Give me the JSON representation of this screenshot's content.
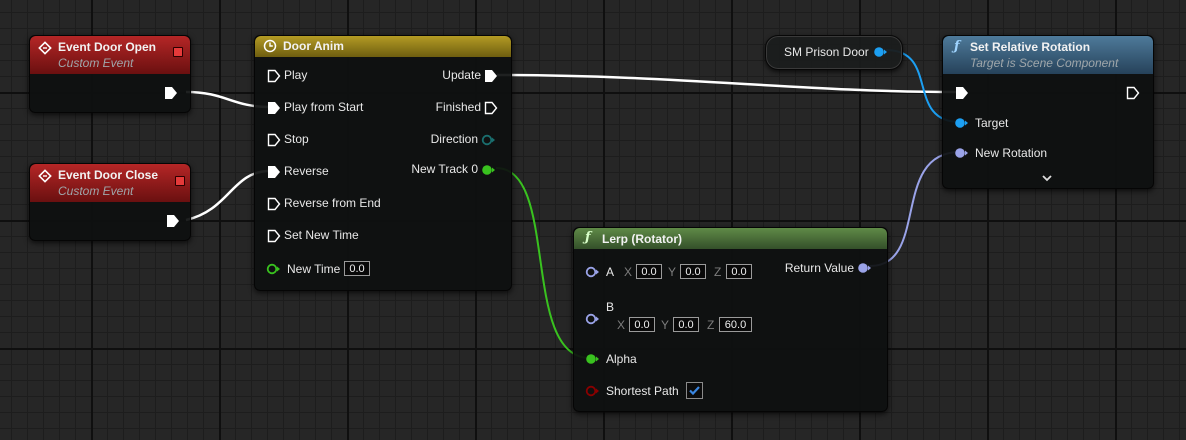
{
  "colors": {
    "exec_pin": "#ffffff",
    "float_pin": "#39c21f",
    "object_pin": "#1c9ff2",
    "rotator_pin": "#9aa3e8",
    "bool_pin": "#8b0000",
    "direction_pin": "#1a6f6f",
    "event_header": "#9b1d1d",
    "timeline_header": "#9e8a20",
    "function_header": "#3b5e79",
    "pure_function_header": "#4a6b38"
  },
  "nodes": {
    "event_open": {
      "title": "Event Door Open",
      "subtitle": "Custom Event"
    },
    "event_close": {
      "title": "Event Door Close",
      "subtitle": "Custom Event"
    },
    "timeline": {
      "title": "Door Anim",
      "inputs": [
        "Play",
        "Play from Start",
        "Stop",
        "Reverse",
        "Reverse from End",
        "Set New Time"
      ],
      "new_time_label": "New Time",
      "new_time_value": "0.0",
      "outputs": {
        "update": "Update",
        "finished": "Finished",
        "direction": "Direction",
        "track": "New Track 0"
      }
    },
    "variable": {
      "label": "SM Prison Door"
    },
    "set_rotation": {
      "title": "Set Relative Rotation",
      "subtitle": "Target is Scene Component",
      "target_label": "Target",
      "rotation_label": "New Rotation"
    },
    "lerp": {
      "title": "Lerp (Rotator)",
      "a_label": "A",
      "a": {
        "x": "0.0",
        "y": "0.0",
        "z": "0.0"
      },
      "b_label": "B",
      "b": {
        "x": "0.0",
        "y": "0.0",
        "z": "60.0"
      },
      "alpha_label": "Alpha",
      "shortest_label": "Shortest Path",
      "shortest_checked": true,
      "return_label": "Return Value",
      "axis_x": "X",
      "axis_y": "Y",
      "axis_z": "Z"
    }
  }
}
